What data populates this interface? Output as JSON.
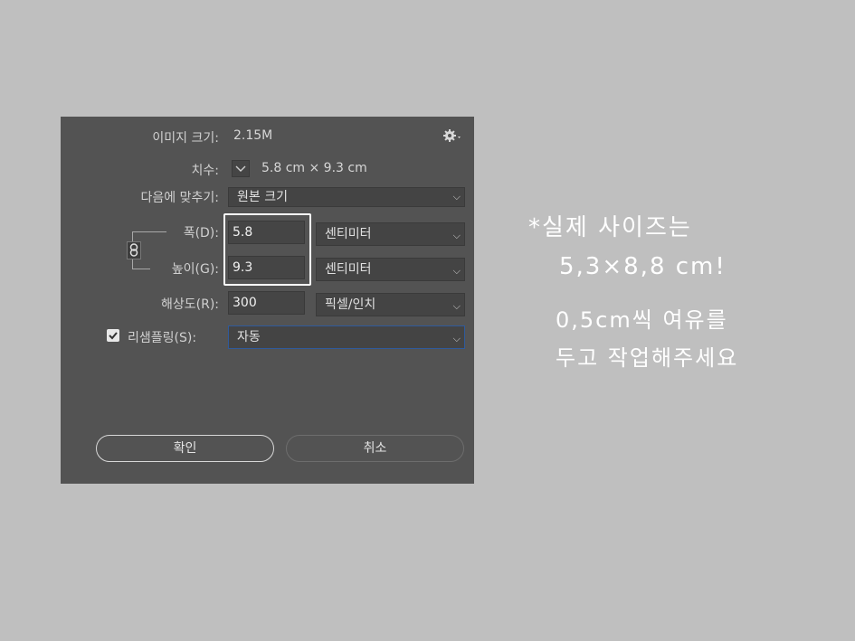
{
  "dialog": {
    "image_size_label": "이미지 크기:",
    "image_size_value": "2.15M",
    "dimensions_label": "치수:",
    "dimensions_value": "5.8 cm  ×  9.3 cm",
    "fit_to_label": "다음에 맞추기:",
    "fit_to_value": "원본 크기",
    "width_label": "폭(D):",
    "width_value": "5.8",
    "width_unit": "센티미터",
    "height_label": "높이(G):",
    "height_value": "9.3",
    "height_unit": "센티미터",
    "resolution_label": "해상도(R):",
    "resolution_value": "300",
    "resolution_unit": "픽셀/인치",
    "resample_label": "리샘플링(S):",
    "resample_value": "자동",
    "resample_checked": true,
    "ok_label": "확인",
    "cancel_label": "취소"
  },
  "annotation": {
    "line1": "*실제 사이즈는",
    "line2": "5,3×8,8 cm!",
    "line3": "0,5cm씩 여유를",
    "line4": "두고 작업해주세요"
  },
  "colors": {
    "page_bg": "#bfbfbf",
    "dialog_bg": "#535353",
    "focus_border": "#2f5a9c",
    "highlight_box": "#ffffff"
  }
}
